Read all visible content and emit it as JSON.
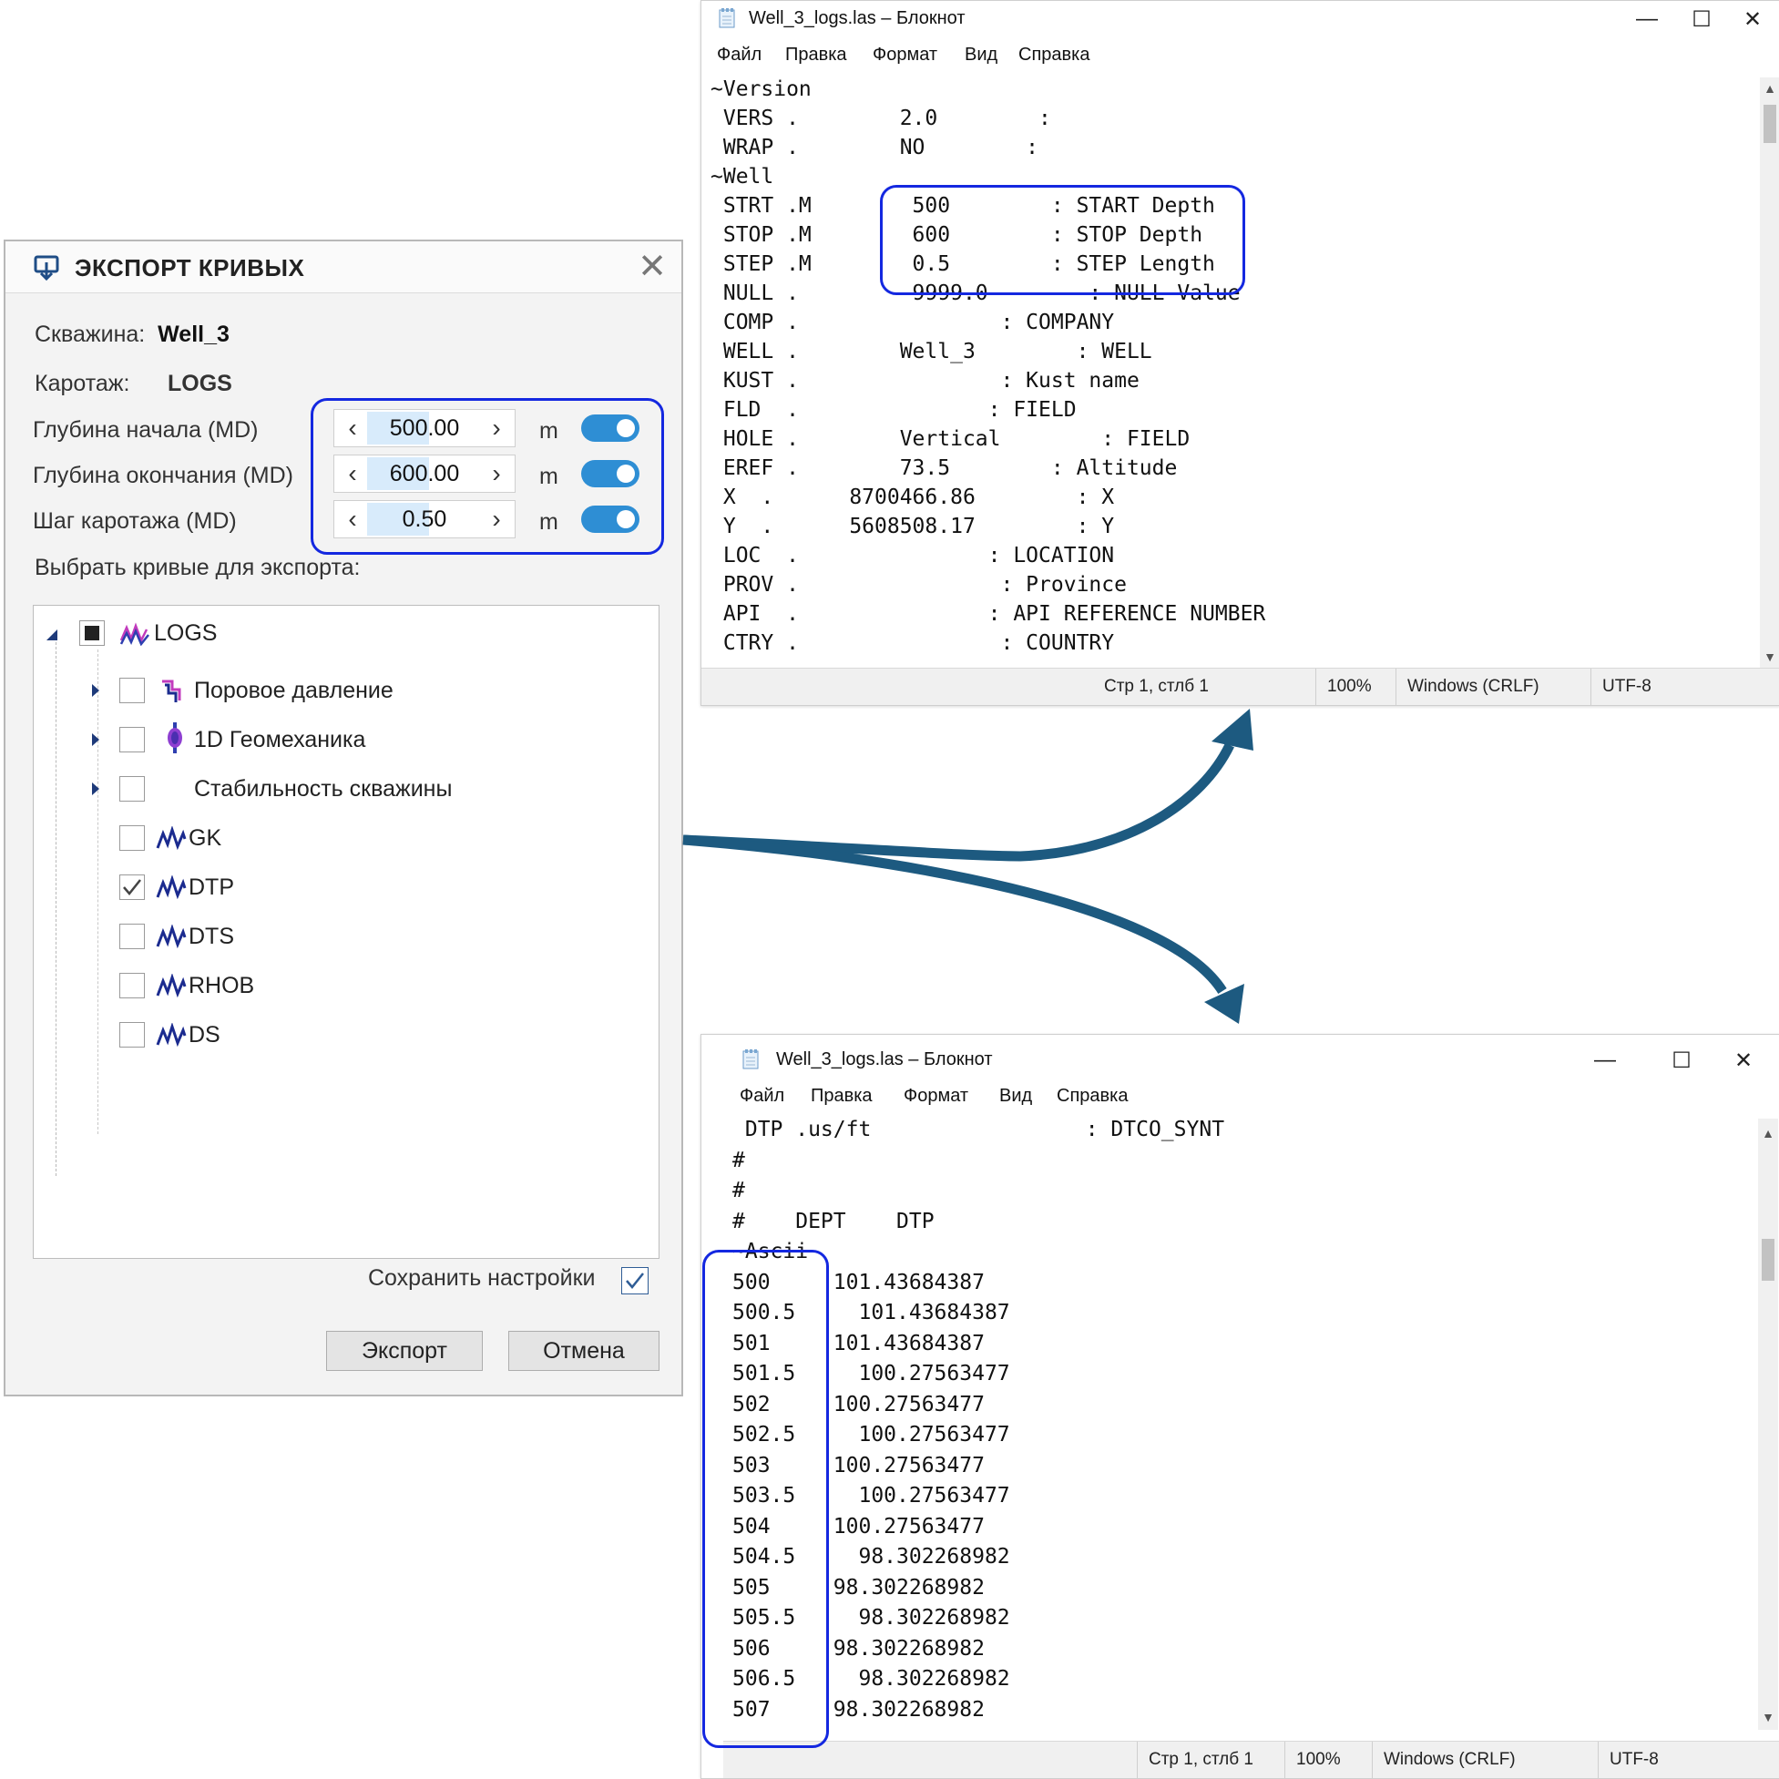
{
  "notepad_top": {
    "title": "Well_3_logs.las – Блокнот",
    "menu": [
      "Файл",
      "Правка",
      "Формат",
      "Вид",
      "Справка"
    ],
    "lines": [
      "~Version",
      " VERS .        2.0        :",
      " WRAP .        NO        :",
      "~Well",
      " STRT .M        500        : START Depth",
      " STOP .M        600        : STOP Depth",
      " STEP .M        0.5        : STEP Length",
      " NULL .        -9999.0        : NULL Value",
      " COMP .                : COMPANY",
      " WELL .        Well_3        : WELL",
      " KUST .                : Kust name",
      " FLD  .               : FIELD",
      " HOLE .        Vertical        : FIELD",
      " EREF .        73.5        : Altitude",
      " X  .      8700466.86        : X",
      " Y  .      5608508.17        : Y",
      " LOC  .               : LOCATION",
      " PROV .                : Province",
      " API  .               : API REFERENCE NUMBER",
      " CTRY .                : COUNTRY"
    ],
    "status": {
      "pos": "Стр 1, стлб 1",
      "zoom": "100%",
      "eol": "Windows (CRLF)",
      "enc": "UTF-8"
    }
  },
  "notepad_bottom": {
    "title": "Well_3_logs.las – Блокнот",
    "menu": [
      "Файл",
      "Правка",
      "Формат",
      "Вид",
      "Справка"
    ],
    "lines": [
      " DTP .us/ft                 : DTCO_SYNT",
      "#",
      "#",
      "#    DEPT    DTP",
      "~Ascii",
      "500     101.43684387",
      "500.5     101.43684387",
      "501     101.43684387",
      "501.5     100.27563477",
      "502     100.27563477",
      "502.5     100.27563477",
      "503     100.27563477",
      "503.5     100.27563477",
      "504     100.27563477",
      "504.5     98.302268982",
      "505     98.302268982",
      "505.5     98.302268982",
      "506     98.302268982",
      "506.5     98.302268982",
      "507     98.302268982"
    ],
    "status": {
      "pos": "Стр 1, стлб 1",
      "zoom": "100%",
      "eol": "Windows (CRLF)",
      "enc": "UTF-8"
    }
  },
  "dialog": {
    "title": "ЭКСПОРТ КРИВЫХ",
    "well_label": "Скважина:",
    "well_value": "Well_3",
    "log_label": "Каротаж:",
    "log_value": "LOGS",
    "start_label": "Глубина начала (MD)",
    "start_value": "500.00",
    "end_label": "Глубина окончания (MD)",
    "end_value": "600.00",
    "step_label": "Шаг каротажа (MD)",
    "step_value": "0.50",
    "unit": "m",
    "select_label": "Выбрать кривые для экспорта:",
    "tree": {
      "root": "LOGS",
      "groups": [
        "Поровое давление",
        "1D Геомеханика",
        "Стабильность скважины"
      ],
      "curves": [
        {
          "name": "GK",
          "checked": false
        },
        {
          "name": "DTP",
          "checked": true
        },
        {
          "name": "DTS",
          "checked": false
        },
        {
          "name": "RHOB",
          "checked": false
        },
        {
          "name": "DS",
          "checked": false
        }
      ]
    },
    "save_label": "Сохранить настройки",
    "export_btn": "Экспорт",
    "cancel_btn": "Отмена",
    "accent": "#2e8ed4",
    "highlight": "#1428e0",
    "arrow_color": "#1d5a80"
  }
}
